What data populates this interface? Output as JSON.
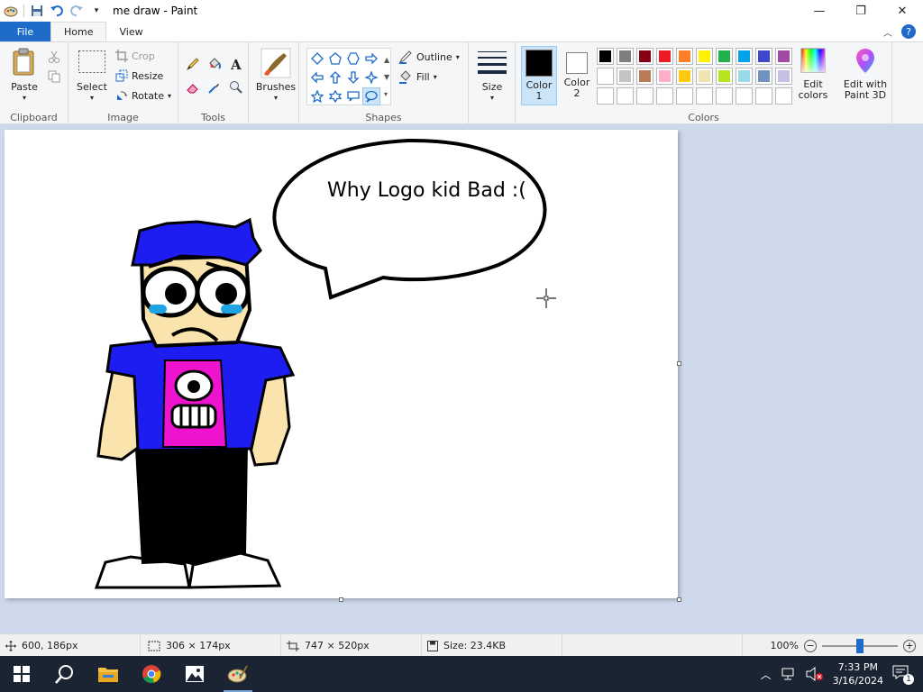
{
  "window": {
    "title": "me draw - Paint",
    "controls": {
      "minimize": "—",
      "maximize": "❐",
      "close": "✕"
    }
  },
  "tabs": {
    "file": "File",
    "home": "Home",
    "view": "View"
  },
  "ribbon": {
    "clipboard": {
      "label": "Clipboard",
      "paste": "Paste"
    },
    "image": {
      "label": "Image",
      "select": "Select",
      "crop": "Crop",
      "resize": "Resize",
      "rotate": "Rotate"
    },
    "tools": {
      "label": "Tools"
    },
    "brushes": {
      "label": "Brushes"
    },
    "shapes": {
      "label": "Shapes",
      "outline": "Outline",
      "fill": "Fill"
    },
    "size": {
      "label": "Size"
    },
    "colors": {
      "label": "Colors",
      "color1_label": "Color",
      "color1_num": "1",
      "color2_label": "Color",
      "color2_num": "2",
      "color1_value": "#000000",
      "color2_value": "#ffffff",
      "edit_colors_line1": "Edit",
      "edit_colors_line2": "colors",
      "paint3d_line1": "Edit with",
      "paint3d_line2": "Paint 3D",
      "palette_row1": [
        "#000000",
        "#7f7f7f",
        "#880015",
        "#ed1c24",
        "#ff7f27",
        "#fff200",
        "#22b14c",
        "#00a2e8",
        "#3f48cc",
        "#a349a4"
      ],
      "palette_row2": [
        "#ffffff",
        "#c3c3c3",
        "#b97a57",
        "#ffaec9",
        "#ffc90e",
        "#efe4b0",
        "#b5e61d",
        "#99d9ea",
        "#7092be",
        "#c8bfe7"
      ]
    }
  },
  "canvas": {
    "speech_text": "Why Logo kid Bad :("
  },
  "status": {
    "cursor_pos": "600, 186px",
    "selection_size": "306 × 174px",
    "image_size": "747 × 520px",
    "file_size": "Size: 23.4KB",
    "zoom": "100%",
    "zoom_fraction": 0.5
  },
  "taskbar": {
    "time": "7:33 PM",
    "date": "3/16/2024",
    "notifications": "1"
  }
}
